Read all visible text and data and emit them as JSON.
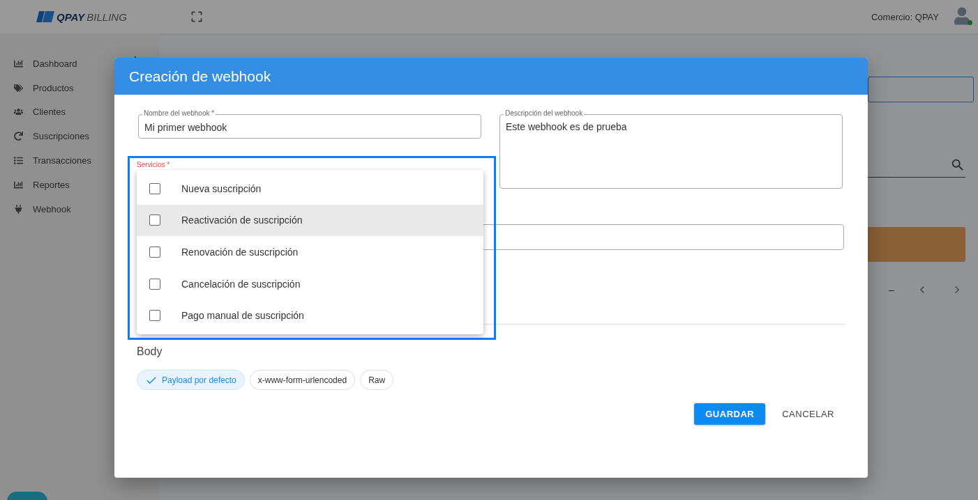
{
  "header": {
    "logo_bold": "QPAY",
    "logo_light": "BILLING",
    "merchant": "Comercio: QPAY"
  },
  "sidebar": {
    "items": [
      {
        "label": "Dashboard"
      },
      {
        "label": "Productos"
      },
      {
        "label": "Clientes"
      },
      {
        "label": "Suscripciones"
      },
      {
        "label": "Transacciones"
      },
      {
        "label": "Reportes"
      },
      {
        "label": "Webhook"
      }
    ]
  },
  "background": {
    "pagination": "–"
  },
  "modal": {
    "title": "Creación de webhook",
    "name_field": {
      "label": "Nombre del webhook *",
      "value": "Mi primer webhook"
    },
    "description_field": {
      "label": "Descripción del webhook",
      "value": "Este webhook es de prueba"
    },
    "services": {
      "label": "Servicios *",
      "options": [
        {
          "label": "Nueva suscripción",
          "checked": false,
          "hovered": false
        },
        {
          "label": "Reactivación de suscripción",
          "checked": false,
          "hovered": true
        },
        {
          "label": "Renovación de suscripción",
          "checked": false,
          "hovered": false
        },
        {
          "label": "Cancelación de suscripción",
          "checked": false,
          "hovered": false
        },
        {
          "label": "Pago manual de suscripción",
          "checked": false,
          "hovered": false
        }
      ]
    },
    "body": {
      "title": "Body",
      "chips": [
        {
          "label": "Payload por defecto",
          "selected": true
        },
        {
          "label": "x-www-form-urlencoded",
          "selected": false
        },
        {
          "label": "Raw",
          "selected": false
        }
      ]
    },
    "buttons": [
      {
        "label": "GUARDAR",
        "kind": "primary"
      },
      {
        "label": "CANCELAR",
        "kind": "text"
      }
    ]
  }
}
